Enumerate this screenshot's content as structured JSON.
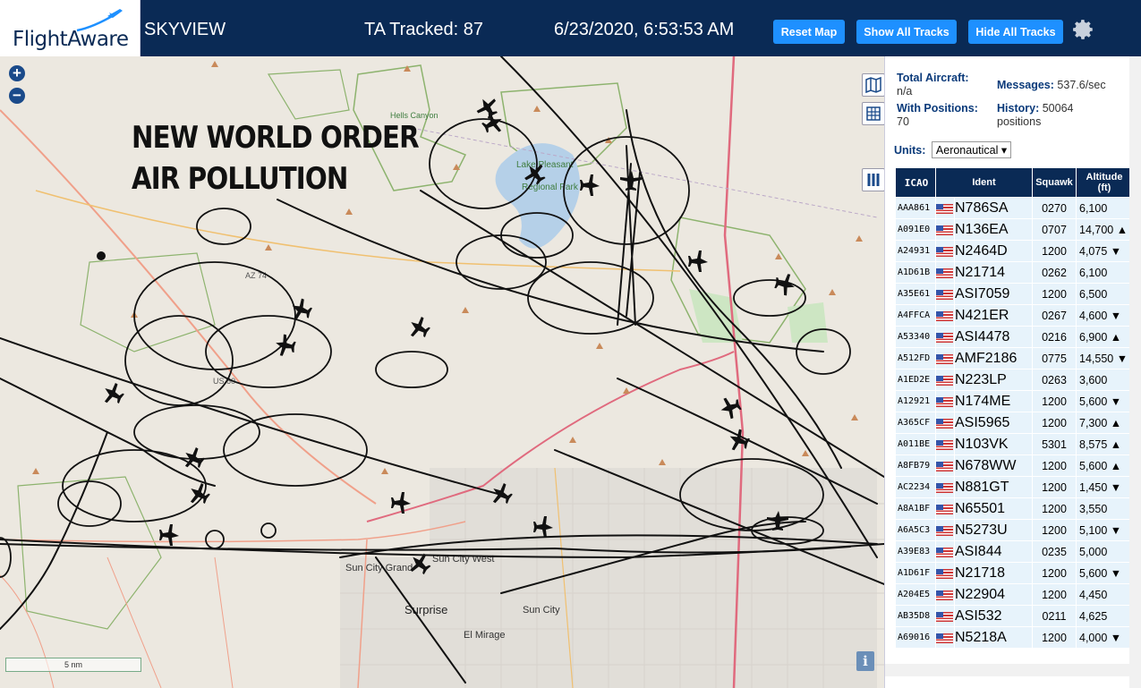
{
  "header": {
    "logo_text": "FlightAware",
    "app_title": "SKYVIEW",
    "ta_tracked": "TA Tracked: 87",
    "datetime": "6/23/2020, 6:53:53 AM",
    "reset_map": "Reset Map",
    "show_all_tracks": "Show All Tracks",
    "hide_all_tracks": "Hide All Tracks",
    "settings_icon": "gear-icon"
  },
  "map": {
    "overlay_line1": "NEW WORLD ORDER",
    "overlay_line2": "AIR POLLUTION",
    "zoom_in": "+",
    "zoom_out": "−",
    "scale": "5 nm",
    "info": "i",
    "labels": {
      "hells_canyon": "Hells Canyon",
      "lake_pleasant": "Lake Pleasant",
      "regional_park": "Regional Park",
      "sun_city_west": "Sun City West",
      "sun_city_grand": "Sun City Grand",
      "surprise": "Surprise",
      "sun_city": "Sun City",
      "el_mirage": "El Mirage",
      "az74": "AZ 74",
      "us60": "US 60"
    }
  },
  "panel": {
    "total_aircraft_label": "Total Aircraft:",
    "total_aircraft_value": "n/a",
    "with_positions_label": "With Positions:",
    "with_positions_value": "70",
    "messages_label": "Messages:",
    "messages_value": "537.6/sec",
    "history_label": "History:",
    "history_value": "50064",
    "history_unit": "positions",
    "units_label": "Units:",
    "units_value": "Aeronautical",
    "columns": [
      "ICAO",
      "Ident",
      "Squawk",
      "Altitude (ft)"
    ],
    "rows": [
      {
        "icao": "AAA861",
        "ident": "N786SA",
        "squawk": "0270",
        "alt": "6,100"
      },
      {
        "icao": "A091E0",
        "ident": "N136EA",
        "squawk": "0707",
        "alt": "14,700 ▲"
      },
      {
        "icao": "A24931",
        "ident": "N2464D",
        "squawk": "1200",
        "alt": "4,075 ▼"
      },
      {
        "icao": "A1D61B",
        "ident": "N21714",
        "squawk": "0262",
        "alt": "6,100"
      },
      {
        "icao": "A35E61",
        "ident": "ASI7059",
        "squawk": "1200",
        "alt": "6,500"
      },
      {
        "icao": "A4FFCA",
        "ident": "N421ER",
        "squawk": "0267",
        "alt": "4,600 ▼"
      },
      {
        "icao": "A53340",
        "ident": "ASI4478",
        "squawk": "0216",
        "alt": "6,900 ▲"
      },
      {
        "icao": "A512FD",
        "ident": "AMF2186",
        "squawk": "0775",
        "alt": "14,550 ▼"
      },
      {
        "icao": "A1ED2E",
        "ident": "N223LP",
        "squawk": "0263",
        "alt": "3,600"
      },
      {
        "icao": "A12921",
        "ident": "N174ME",
        "squawk": "1200",
        "alt": "5,600 ▼"
      },
      {
        "icao": "A365CF",
        "ident": "ASI5965",
        "squawk": "1200",
        "alt": "7,300 ▲"
      },
      {
        "icao": "A011BE",
        "ident": "N103VK",
        "squawk": "5301",
        "alt": "8,575 ▲"
      },
      {
        "icao": "A8FB79",
        "ident": "N678WW",
        "squawk": "1200",
        "alt": "5,600 ▲"
      },
      {
        "icao": "AC2234",
        "ident": "N881GT",
        "squawk": "1200",
        "alt": "1,450 ▼"
      },
      {
        "icao": "A8A1BF",
        "ident": "N65501",
        "squawk": "1200",
        "alt": "3,550"
      },
      {
        "icao": "A6A5C3",
        "ident": "N5273U",
        "squawk": "1200",
        "alt": "5,100 ▼"
      },
      {
        "icao": "A39E83",
        "ident": "ASI844",
        "squawk": "0235",
        "alt": "5,000"
      },
      {
        "icao": "A1D61F",
        "ident": "N21718",
        "squawk": "1200",
        "alt": "5,600 ▼"
      },
      {
        "icao": "A204E5",
        "ident": "N22904",
        "squawk": "1200",
        "alt": "4,450"
      },
      {
        "icao": "AB35D8",
        "ident": "ASI532",
        "squawk": "0211",
        "alt": "4,625"
      },
      {
        "icao": "A69016",
        "ident": "N5218A",
        "squawk": "1200",
        "alt": "4,000 ▼"
      }
    ]
  },
  "colors": {
    "header_bg": "#0a2a55",
    "button": "#1e90ff",
    "row_bg": "#e7f3fb",
    "track": "#111111"
  }
}
